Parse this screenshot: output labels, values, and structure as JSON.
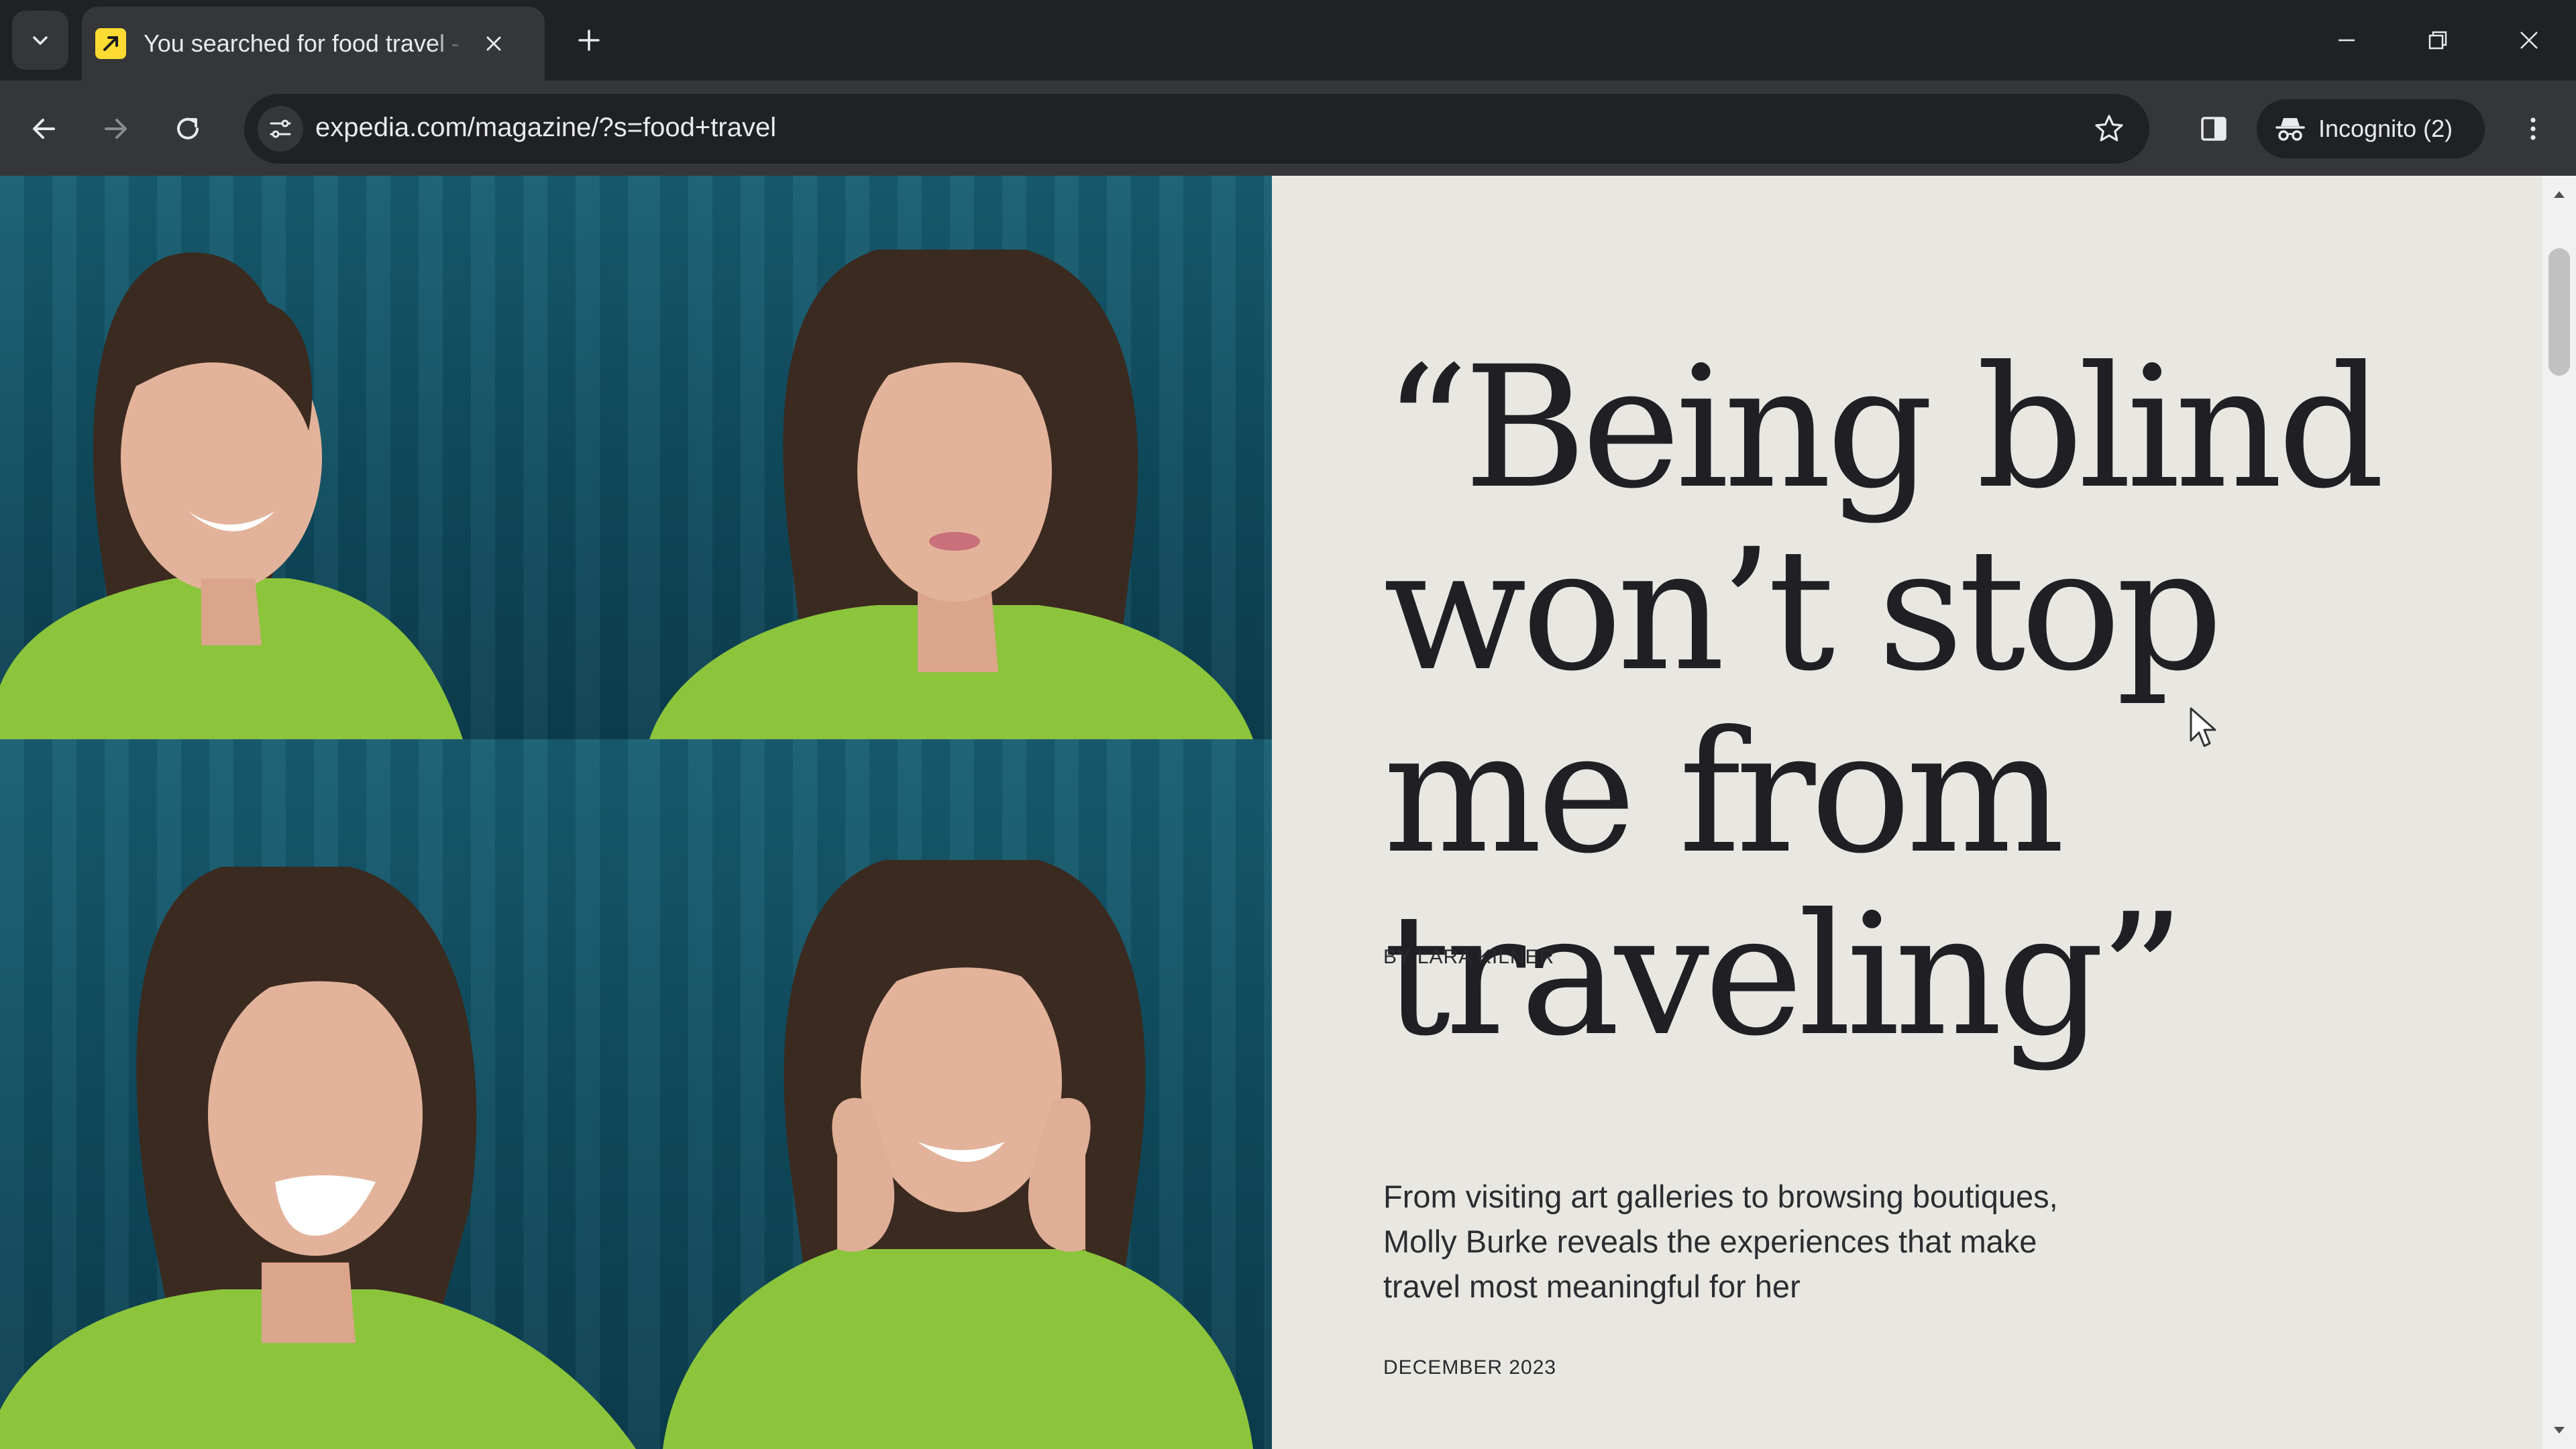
{
  "browser": {
    "tab": {
      "title": "You searched for food travel - Expedia",
      "favicon": "expedia-favicon"
    },
    "url": "expedia.com/magazine/?s=food+travel",
    "profile_label": "Incognito (2)"
  },
  "article": {
    "headline": "“Being blind won’t stop me from traveling”",
    "byline": "BY LARA KILNER",
    "dek": "From visiting art galleries to browsing boutiques, Molly Burke reveals the experiences that make travel most meaningful for her",
    "date": "DECEMBER 2023"
  },
  "colors": {
    "chrome_dark": "#202124",
    "chrome_toolbar": "#35363a",
    "page_background": "#e9e7e2",
    "photo_backdrop": "#185e72",
    "sweater": "#8cc43c",
    "favicon_yellow": "#fddb32"
  }
}
